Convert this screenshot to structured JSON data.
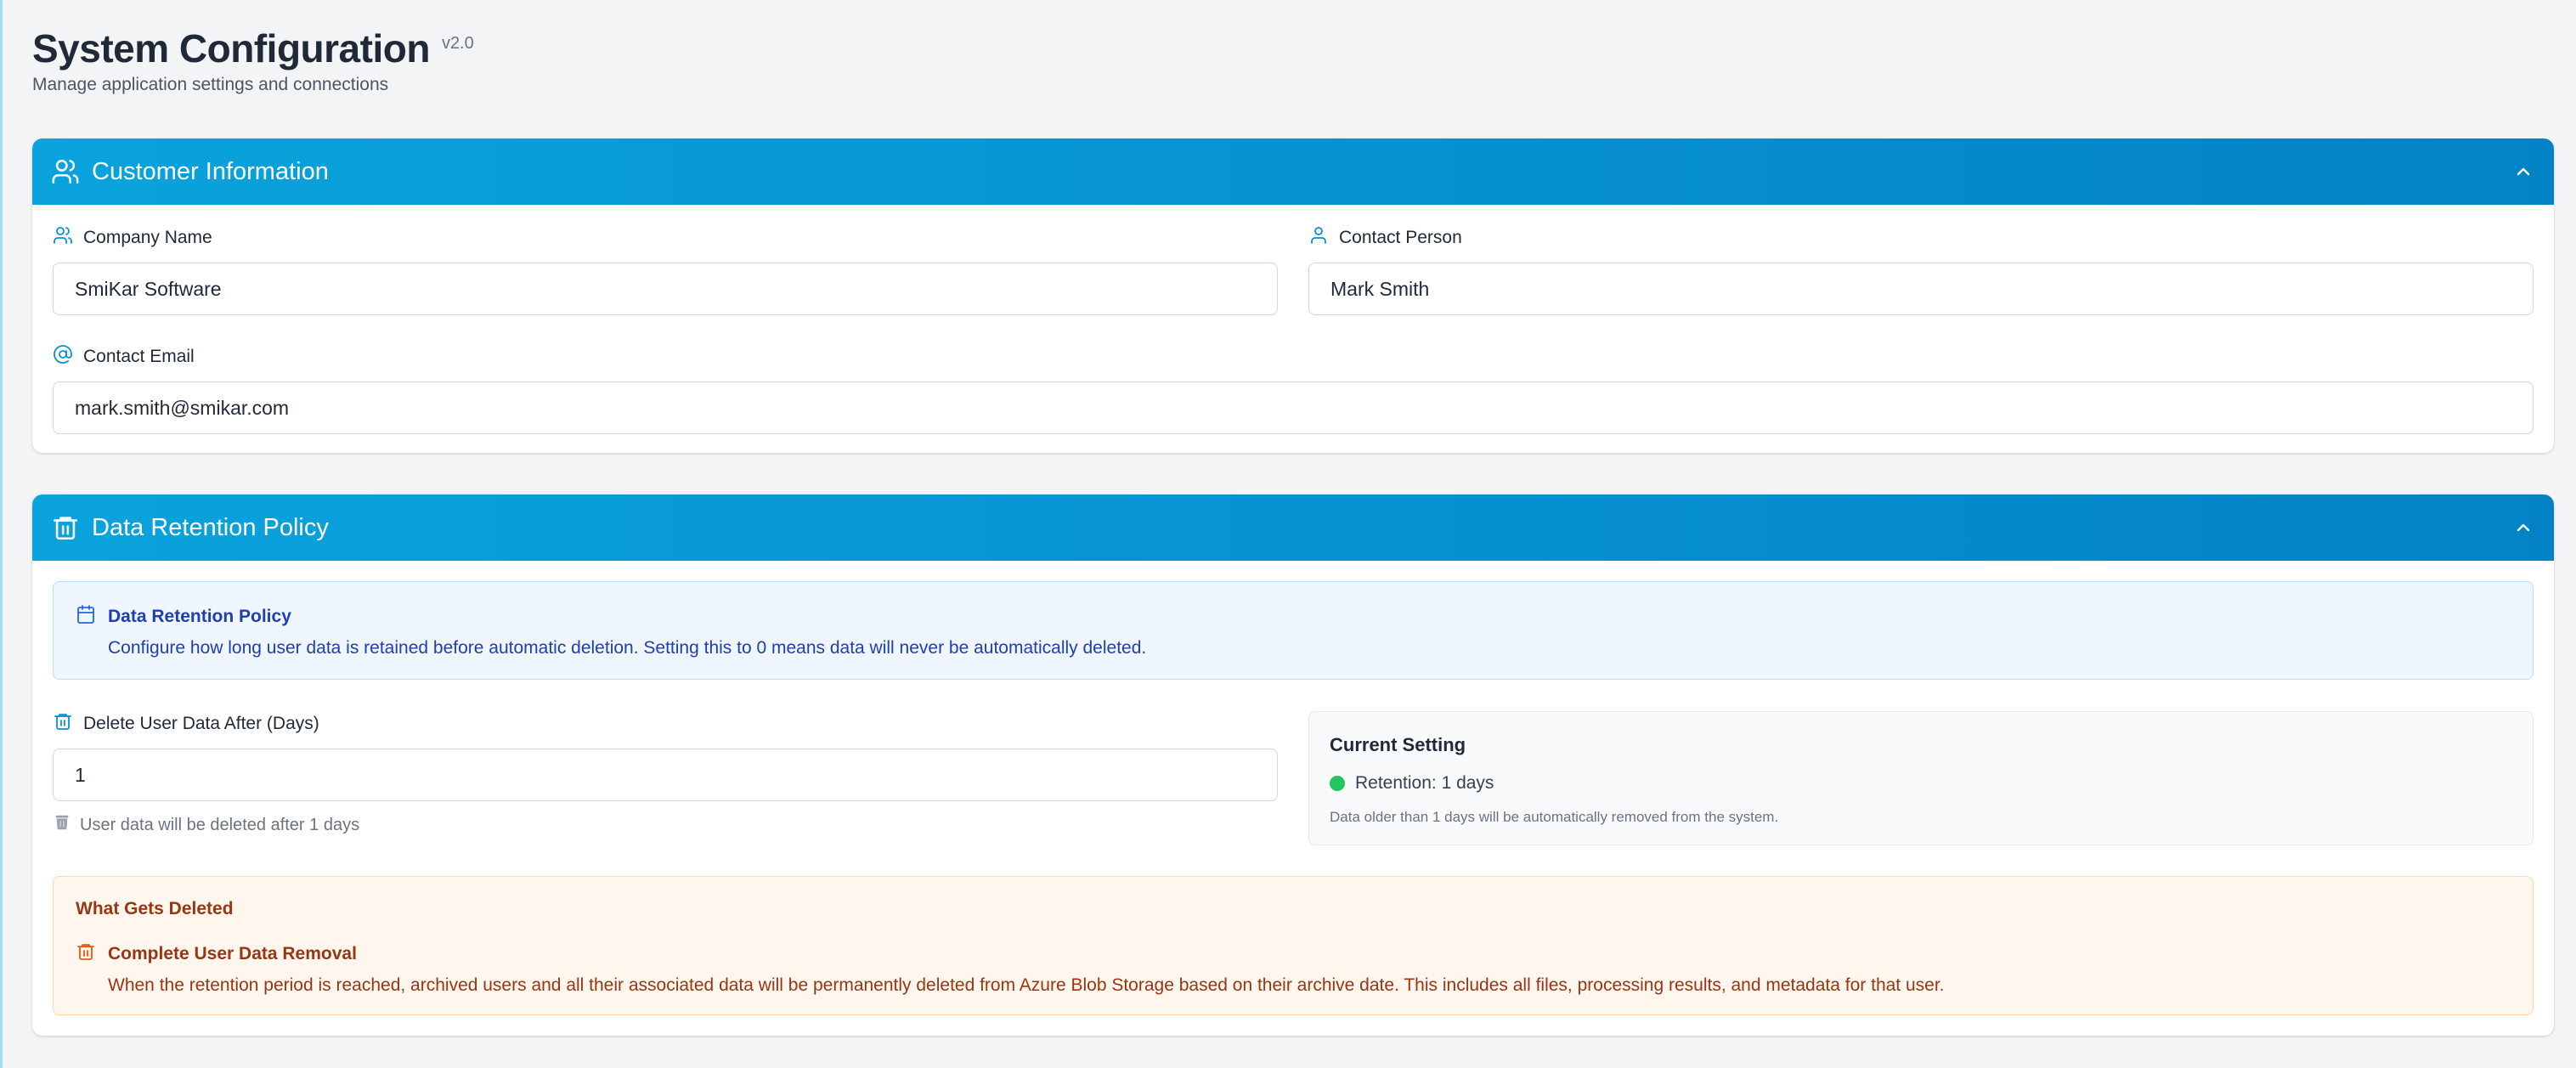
{
  "header": {
    "title": "System Configuration",
    "version": "v2.0",
    "subtitle": "Manage application settings and connections"
  },
  "customer": {
    "section_title": "Customer Information",
    "section_icon": "users-icon",
    "collapse_icon": "chevron-up-icon",
    "company_name": {
      "label": "Company Name",
      "value": "SmiKar Software",
      "icon": "users-icon"
    },
    "contact_person": {
      "label": "Contact Person",
      "value": "Mark Smith",
      "icon": "user-icon"
    },
    "contact_email": {
      "label": "Contact Email",
      "value": "mark.smith@smikar.com",
      "icon": "at-sign-icon"
    }
  },
  "retention": {
    "section_title": "Data Retention Policy",
    "section_icon": "trash-icon",
    "collapse_icon": "chevron-up-icon",
    "info": {
      "title": "Data Retention Policy",
      "text": "Configure how long user data is retained before automatic deletion. Setting this to 0 means data will never be automatically deleted.",
      "icon": "calendar-icon"
    },
    "delete_after": {
      "label": "Delete User Data After (Days)",
      "value": "1",
      "hint": "User data will be deleted after 1 days",
      "icon": "trash-icon"
    },
    "current_setting": {
      "title": "Current Setting",
      "status": "Retention: 1 days",
      "note": "Data older than 1 days will be automatically removed from the system.",
      "status_color": "#22c55e"
    },
    "warning": {
      "heading": "What Gets Deleted",
      "title": "Complete User Data Removal",
      "text": "When the retention period is reached, archived users and all their associated data will be permanently deleted from Azure Blob Storage based on their archive date. This includes all files, processing results, and metadata for that user.",
      "icon": "trash-icon"
    }
  },
  "colors": {
    "accent": "#0891d1",
    "info_text": "#1e40af",
    "warning_text": "#9a3412"
  }
}
